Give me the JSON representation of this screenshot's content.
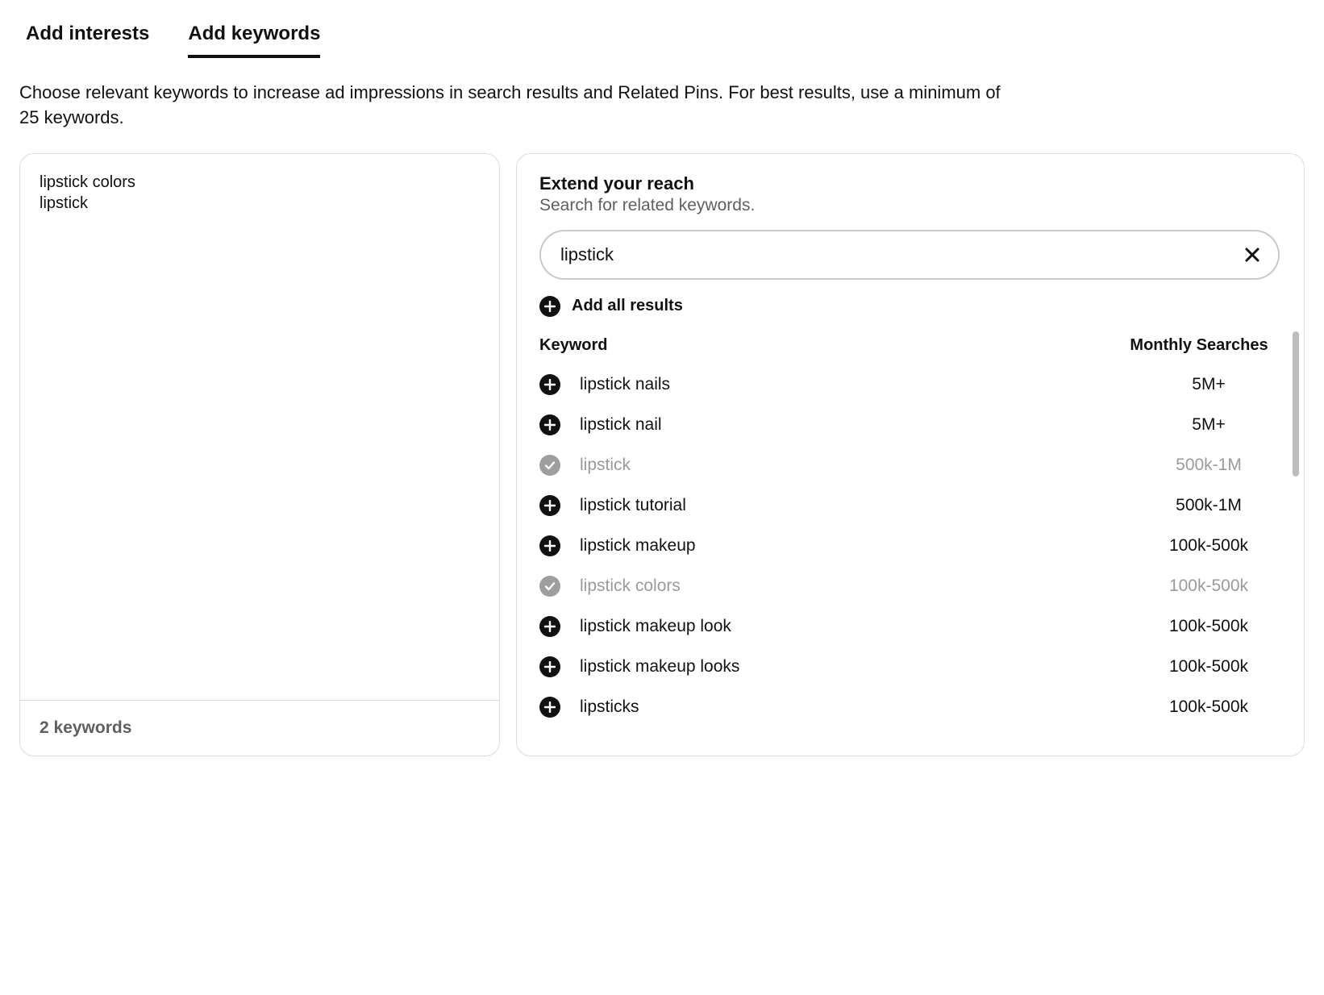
{
  "tabs": {
    "interests": "Add interests",
    "keywords": "Add keywords"
  },
  "description": "Choose relevant keywords to increase ad impressions in search results and Related Pins. For best results, use a minimum of 25 keywords.",
  "keyword_box": {
    "entered": "lipstick colors\nlipstick",
    "count_label": "2 keywords"
  },
  "extend": {
    "title": "Extend your reach",
    "subtitle": "Search for related keywords.",
    "search_value": "lipstick",
    "add_all_label": "Add all results",
    "col_keyword": "Keyword",
    "col_searches": "Monthly Searches",
    "results": [
      {
        "keyword": "lipstick nails",
        "searches": "5M+",
        "added": false
      },
      {
        "keyword": "lipstick nail",
        "searches": "5M+",
        "added": false
      },
      {
        "keyword": "lipstick",
        "searches": "500k-1M",
        "added": true
      },
      {
        "keyword": "lipstick tutorial",
        "searches": "500k-1M",
        "added": false
      },
      {
        "keyword": "lipstick makeup",
        "searches": "100k-500k",
        "added": false
      },
      {
        "keyword": "lipstick colors",
        "searches": "100k-500k",
        "added": true
      },
      {
        "keyword": "lipstick makeup look",
        "searches": "100k-500k",
        "added": false
      },
      {
        "keyword": "lipstick makeup looks",
        "searches": "100k-500k",
        "added": false
      },
      {
        "keyword": "lipsticks",
        "searches": "100k-500k",
        "added": false
      }
    ]
  }
}
